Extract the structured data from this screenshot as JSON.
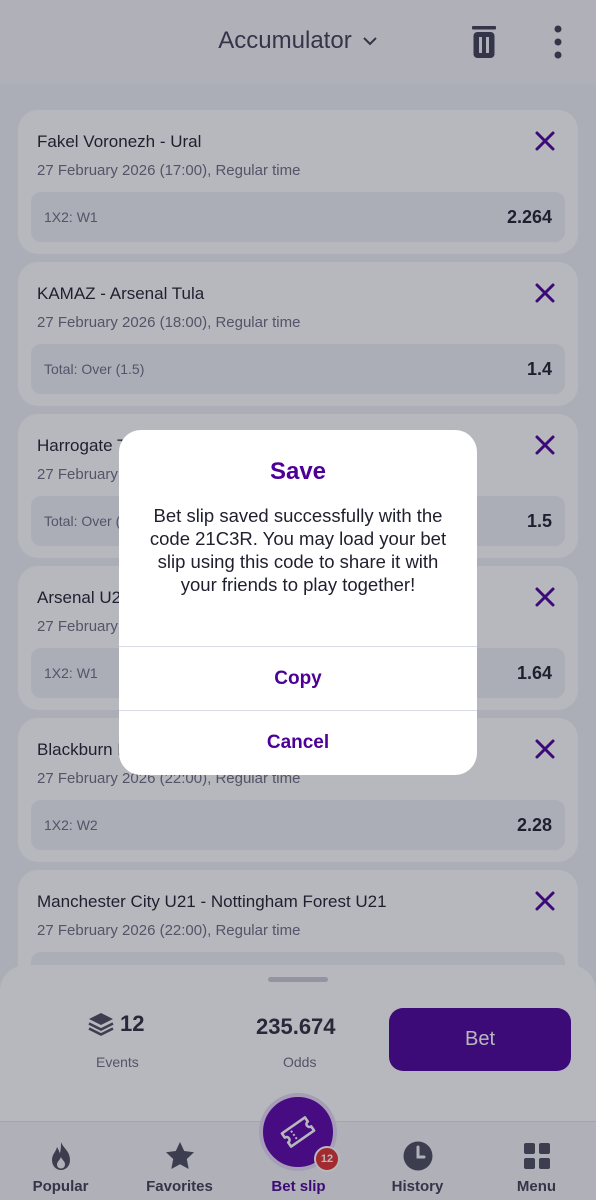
{
  "header": {
    "title": "Accumulator"
  },
  "cards": [
    {
      "match": "Fakel Voronezh - Ural",
      "time": "27 February 2026 (17:00), Regular time",
      "market": "1X2: W1",
      "odd": "2.264"
    },
    {
      "match": "KAMAZ - Arsenal Tula",
      "time": "27 February 2026 (18:00), Regular time",
      "market": "Total: Over (1.5)",
      "odd": "1.4"
    },
    {
      "match": "Harrogate Town - ",
      "time": "27 February 2026 (19:45), Regular time",
      "market": "Total: Over (2.5)",
      "odd": "1.5"
    },
    {
      "match": "Arsenal U21 - ",
      "time": "27 February 2026 (20:00), Regular time",
      "market": "1X2: W1",
      "odd": "1.64"
    },
    {
      "match": "Blackburn Rovers - ",
      "time": "27 February 2026 (22:00), Regular time",
      "market": "1X2: W2",
      "odd": "2.28"
    },
    {
      "match": "Manchester City U21 - Nottingham Forest U21",
      "time": "27 February 2026 (22:00), Regular time",
      "market": "",
      "odd": ""
    }
  ],
  "summary": {
    "events_count": "12",
    "events_label": "Events",
    "odds_value": "235.674",
    "odds_label": "Odds",
    "bet_label": "Bet"
  },
  "nav": {
    "popular": "Popular",
    "favorites": "Favorites",
    "betslip": "Bet slip",
    "history": "History",
    "menu": "Menu",
    "betslip_badge": "12"
  },
  "dialog": {
    "title": "Save",
    "message": "Bet slip saved successfully with the code 21C3R. You may load your bet slip using this code to share it with your friends to play together!",
    "copy": "Copy",
    "cancel": "Cancel"
  },
  "colors": {
    "accent": "#4c0098",
    "badge": "#e0302f"
  }
}
